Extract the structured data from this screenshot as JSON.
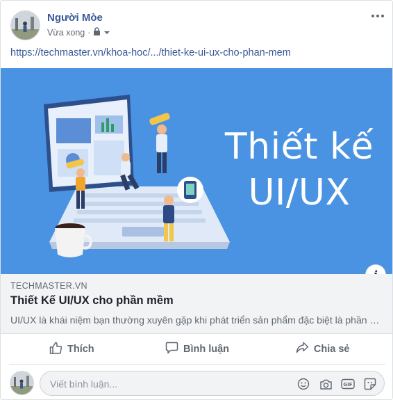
{
  "post": {
    "author_name": "Người Mòe",
    "time": "Vừa xong",
    "separator": "·",
    "link_text": "https://techmaster.vn/khoa-hoc/.../thiet-ke-ui-ux-cho-phan-mem"
  },
  "preview": {
    "hero_title_line1": "Thiết kế",
    "hero_title_line2": "UI/UX",
    "info_label": "i",
    "domain": "TECHMASTER.VN",
    "title": "Thiết Kế UI/UX cho phần mềm",
    "description": "UI/UX là khái niệm bạn thường xuyên gặp khi phát triển sản phẩm đặc biệt là phần mềm"
  },
  "actions": {
    "like_label": "Thích",
    "comment_label": "Bình luận",
    "share_label": "Chia sẻ"
  },
  "comment": {
    "placeholder": "Viết bình luận...",
    "icons": [
      "emoji-icon",
      "camera-icon",
      "gif-icon",
      "sticker-icon"
    ]
  },
  "colors": {
    "accent": "#385898",
    "hero_bg": "#4a92e2",
    "muted": "#606770"
  }
}
